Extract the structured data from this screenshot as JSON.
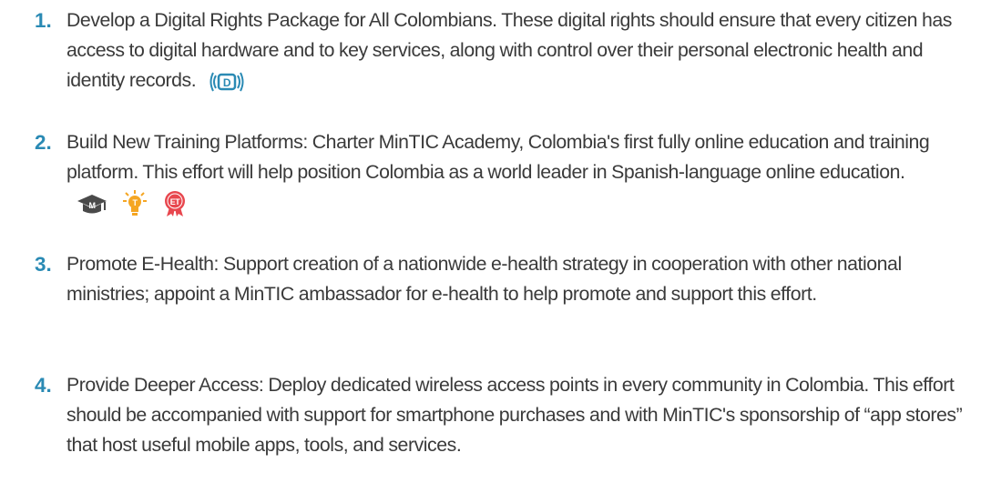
{
  "items": [
    {
      "number": "1.",
      "text": "Develop a Digital Rights Package for All Colombians. These digital rights should ensure that every citizen has access to digital hardware and to key services, along with control over their personal electronic health and identity records.",
      "icons": [
        {
          "name": "digital-rights-icon",
          "letter": "D",
          "color": "#2a8ab4"
        }
      ]
    },
    {
      "number": "2.",
      "text": "Build New Training Platforms: Charter MinTIC Academy, Colombia's first fully online education and training platform. This effort will help position Colombia as a world leader in Spanish-language online education.",
      "icons": [
        {
          "name": "mortarboard-icon",
          "letter": "M",
          "color": "#4a4a4a"
        },
        {
          "name": "lightbulb-icon",
          "letter": "T",
          "color": "#f5a623"
        },
        {
          "name": "medal-icon",
          "letter": "ET",
          "color": "#e8474e"
        }
      ]
    },
    {
      "number": "3.",
      "text": "Promote E-Health: Support creation of a nationwide e-health strategy in cooperation with other national ministries; appoint a MinTIC ambassador for e-health to help promote and support this effort.",
      "icons": []
    },
    {
      "number": "4.",
      "text": "Provide Deeper Access: Deploy dedicated wireless access points in every community in Colombia. This effort should be accompanied with support for smartphone purchases and with MinTIC's sponsorship of “app stores” that host useful mobile apps, tools, and services.",
      "icons": []
    }
  ]
}
